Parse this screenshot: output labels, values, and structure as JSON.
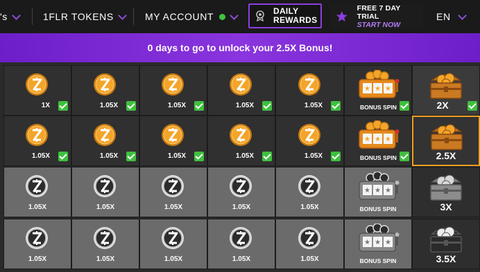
{
  "nav": {
    "partial_item": "'s",
    "tokens_label": "1FLR TOKENS",
    "account_label": "MY ACCOUNT",
    "daily_rewards_line1": "DAILY",
    "daily_rewards_line2": "REWARDS",
    "trial_line1": "FREE 7 DAY TRIAL",
    "trial_line2": "START NOW",
    "language": "EN"
  },
  "banner": {
    "text": "0 days to go to unlock your 2.5X Bonus!"
  },
  "colors": {
    "accent": "#8b3fe0",
    "claimed_check": "#3fbf3f",
    "coin_orange": "#f0a020",
    "current_border": "#f0a020"
  },
  "rows": [
    {
      "days": [
        {
          "label": "1X",
          "claimed": true
        },
        {
          "label": "1.05X",
          "claimed": true
        },
        {
          "label": "1.05X",
          "claimed": true
        },
        {
          "label": "1.05X",
          "claimed": true
        },
        {
          "label": "1.05X",
          "claimed": true
        }
      ],
      "bonus": {
        "label": "BONUS SPIN",
        "claimed": true
      },
      "chest": {
        "label": "2X",
        "claimed": true,
        "current": false
      }
    },
    {
      "days": [
        {
          "label": "1.05X",
          "claimed": true
        },
        {
          "label": "1.05X",
          "claimed": true
        },
        {
          "label": "1.05X",
          "claimed": true
        },
        {
          "label": "1.05X",
          "claimed": true
        },
        {
          "label": "1.05X",
          "claimed": true
        }
      ],
      "bonus": {
        "label": "BONUS SPIN",
        "claimed": true
      },
      "chest": {
        "label": "2.5X",
        "claimed": false,
        "current": true
      }
    },
    {
      "days": [
        {
          "label": "1.05X",
          "claimed": false
        },
        {
          "label": "1.05X",
          "claimed": false
        },
        {
          "label": "1.05X",
          "claimed": false
        },
        {
          "label": "1.05X",
          "claimed": false
        },
        {
          "label": "1.05X",
          "claimed": false
        }
      ],
      "bonus": {
        "label": "BONUS SPIN",
        "claimed": false
      },
      "chest": {
        "label": "3X",
        "claimed": false,
        "current": false
      }
    },
    {
      "days": [
        {
          "label": "1.05X",
          "claimed": false
        },
        {
          "label": "1.05X",
          "claimed": false
        },
        {
          "label": "1.05X",
          "claimed": false
        },
        {
          "label": "1.05X",
          "claimed": false
        },
        {
          "label": "1.05X",
          "claimed": false
        }
      ],
      "bonus": {
        "label": "BONUS SPIN",
        "claimed": false
      },
      "chest": {
        "label": "3.5X",
        "claimed": false,
        "current": false
      }
    }
  ]
}
